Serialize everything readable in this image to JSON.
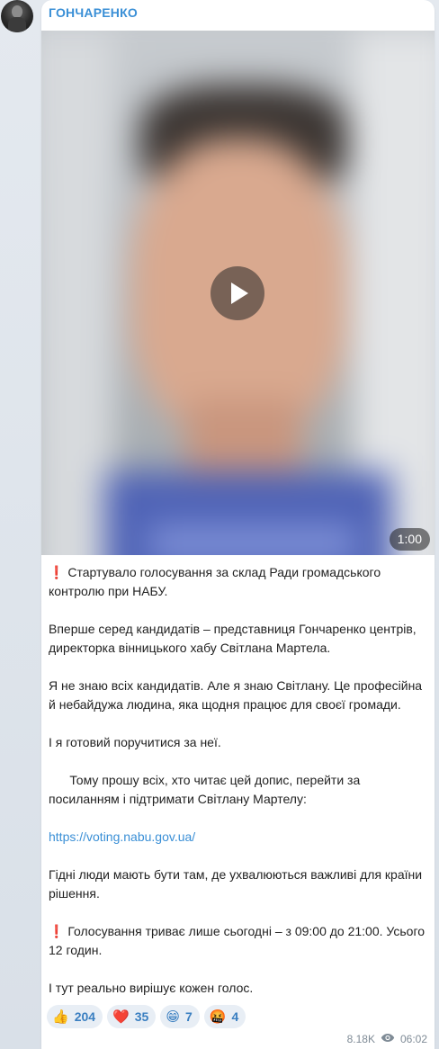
{
  "post": {
    "channel_name": "ГОНЧАРЕНКО",
    "video": {
      "duration": "1:00"
    },
    "paragraphs": [
      {
        "prefix": "❗",
        "text": " Стартувало голосування за склад Ради громадського контролю при НАБУ."
      },
      {
        "prefix": "",
        "text": "Вперше серед кандидатів – представниця Гончаренко центрів, директорка вінницького хабу Світлана Мартела."
      },
      {
        "prefix": "",
        "text": "Я не знаю всіх кандидатів. Але я знаю Світлану. Це професійна й небайдужа людина, яка щодня працює для своєї громади."
      },
      {
        "prefix": "",
        "text": "І я готовий поручитися за неї."
      },
      {
        "prefix": "",
        "text": "      Тому прошу всіх, хто читає цей допис, перейти за посиланням і підтримати Світлану Мартелу:"
      },
      {
        "prefix": "",
        "link": "https://voting.nabu.gov.ua/"
      },
      {
        "prefix": "",
        "text": "Гідні люди мають бути там, де ухвалюються важливі для країни рішення."
      },
      {
        "prefix": "❗",
        "text": " Голосування триває лише сьогодні – з 09:00 до 21:00. Усього 12 годин."
      },
      {
        "prefix": "",
        "text": "І тут реально вирішує кожен голос."
      }
    ],
    "reactions": [
      {
        "emoji": "👍",
        "count": "204"
      },
      {
        "emoji": "❤️",
        "count": "35"
      },
      {
        "emoji": "😁",
        "count": "7"
      },
      {
        "emoji": "🤬",
        "count": "4"
      }
    ],
    "views": "8.18K",
    "time": "06:02",
    "colors": {
      "accent": "#3a8fd6",
      "alert": "#d8342c"
    }
  }
}
